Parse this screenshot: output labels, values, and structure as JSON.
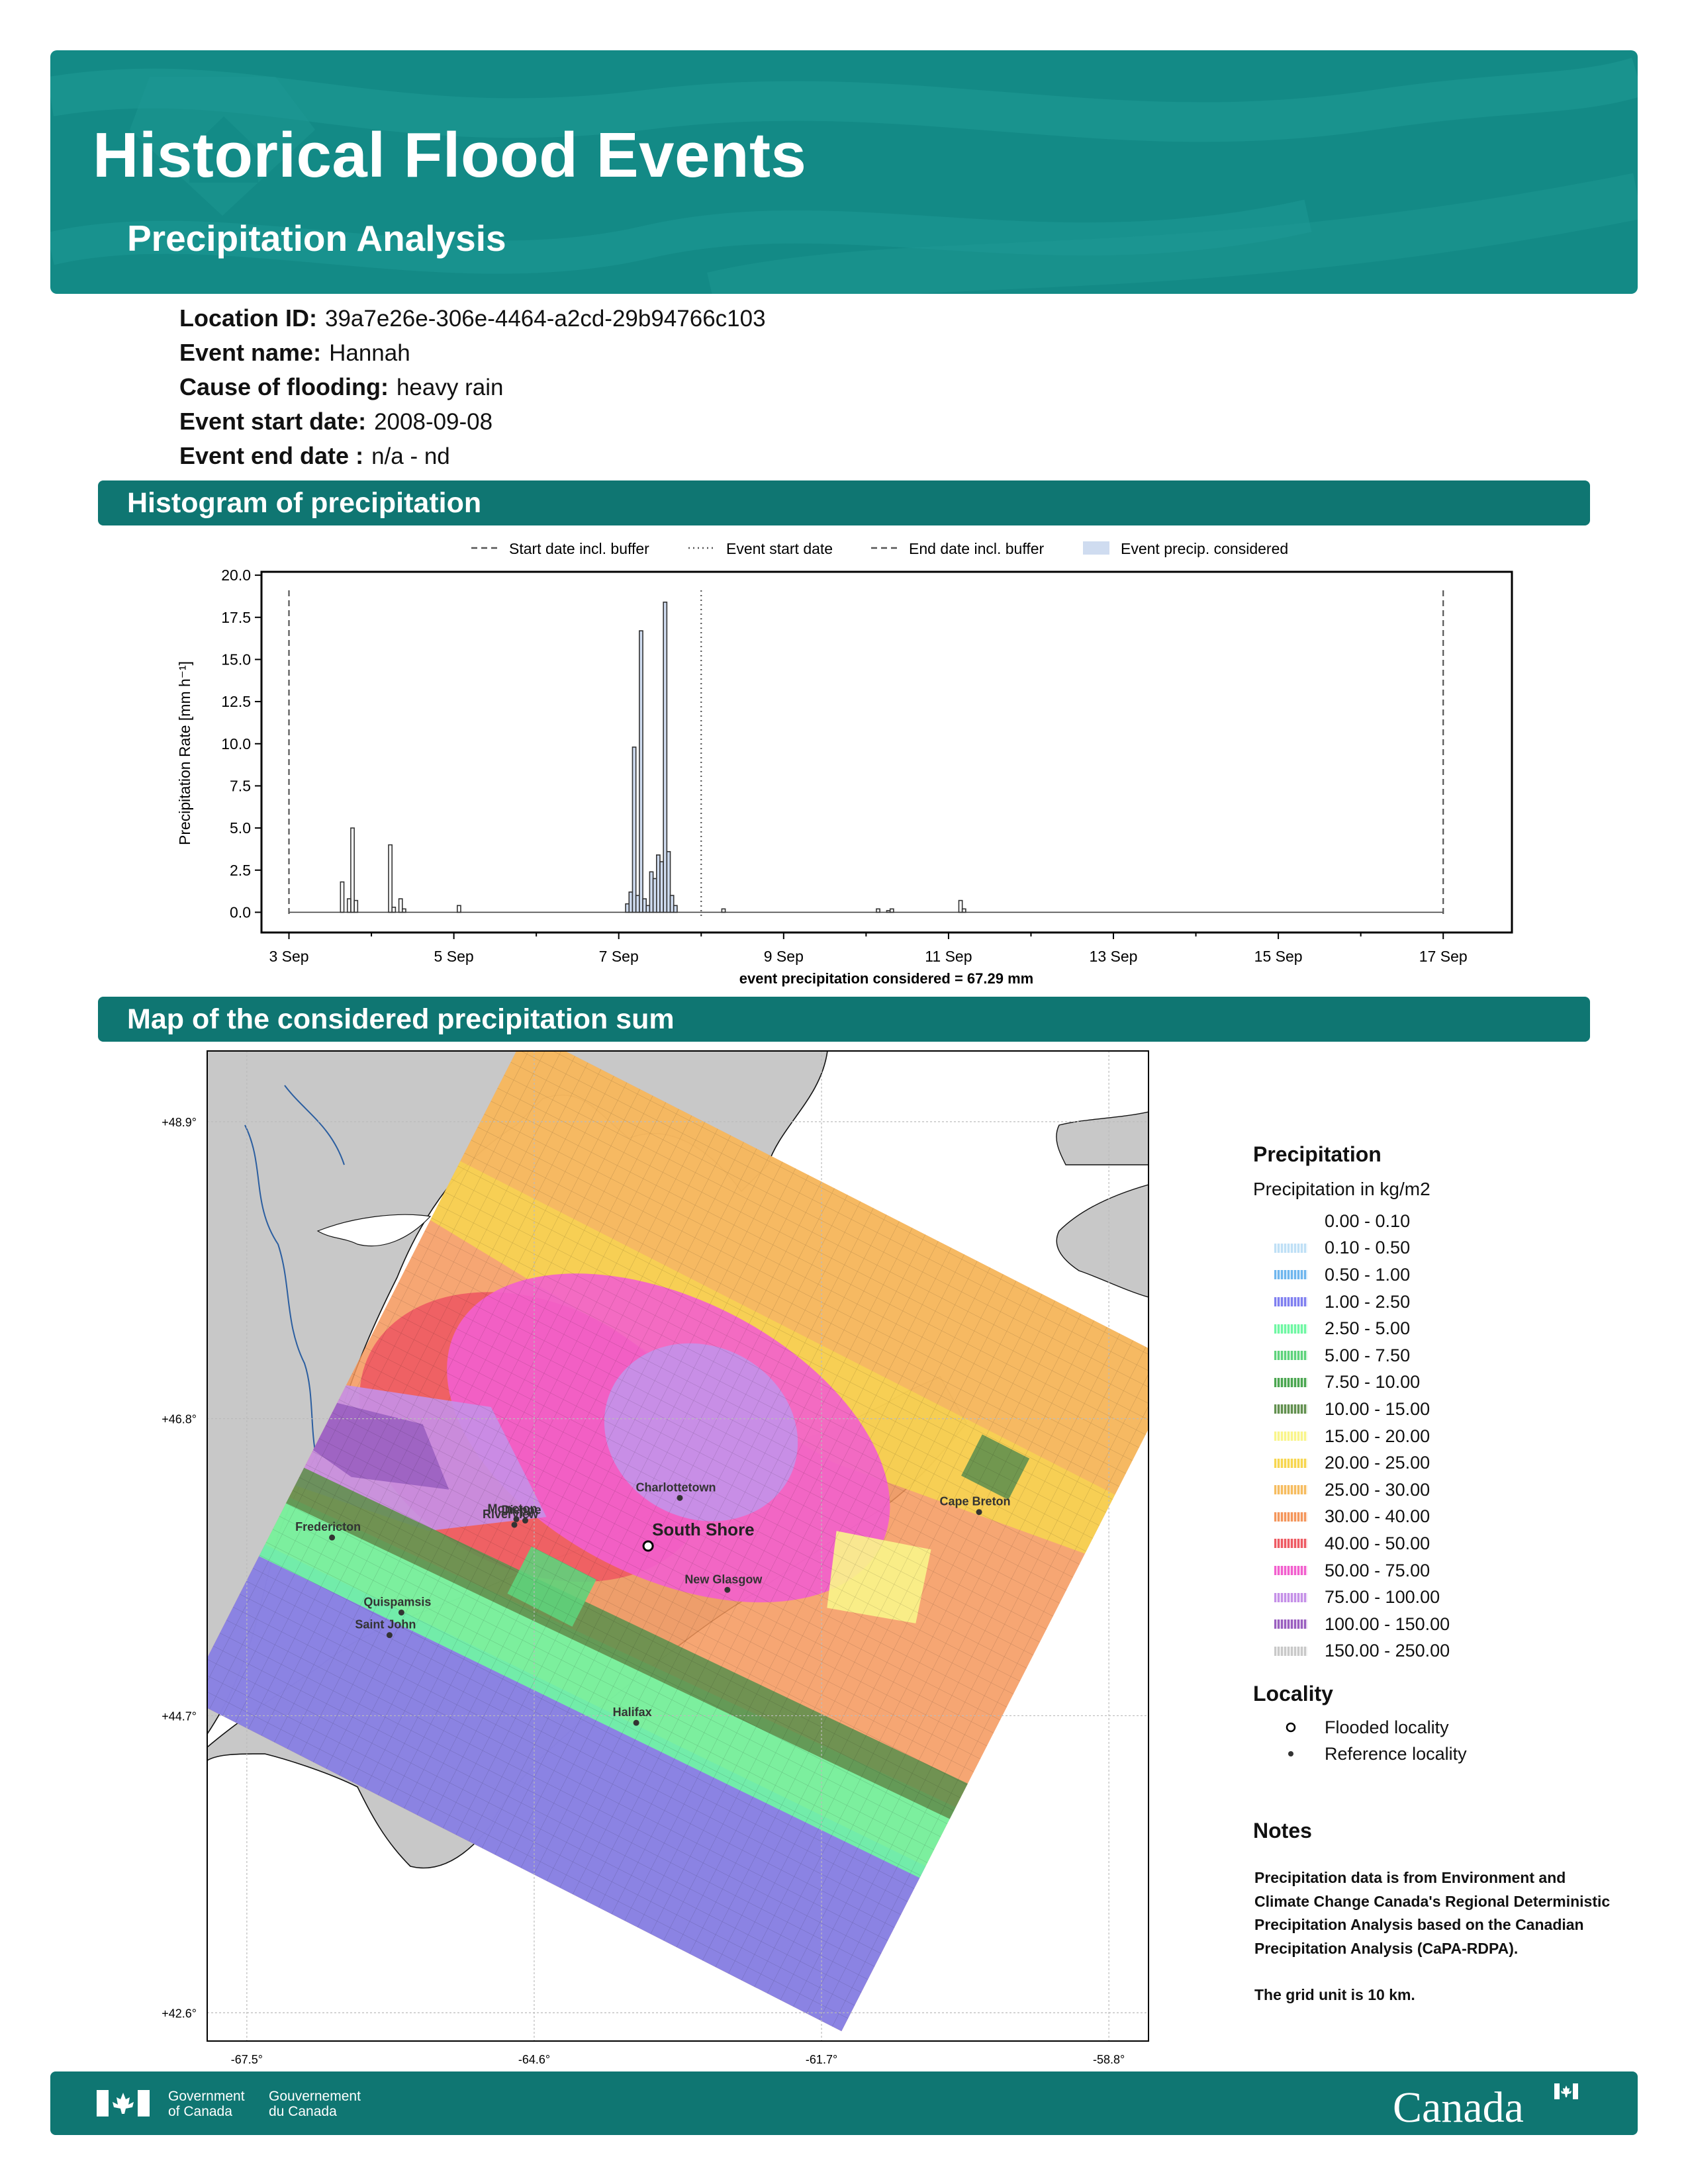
{
  "header": {
    "title": "Historical Flood Events",
    "subtitle": "Precipitation Analysis"
  },
  "event_info": [
    {
      "label": "Location ID:",
      "value": "39a7e26e-306e-4464-a2cd-29b94766c103"
    },
    {
      "label": "Event name:",
      "value": "Hannah"
    },
    {
      "label": "Cause of flooding:",
      "value": "heavy rain"
    },
    {
      "label": "Event start date:",
      "value": "2008-09-08"
    },
    {
      "label": "Event end date :",
      "value": "n/a - nd"
    }
  ],
  "sections": {
    "histogram": "Histogram of precipitation",
    "map": "Map of the considered precipitation sum"
  },
  "chart_data": {
    "type": "bar",
    "ylabel": "Precipitation Rate [mm h⁻¹]",
    "footer_text": "event precipitation considered = 67.29 mm",
    "ylim": [
      -1.2,
      20.2
    ],
    "xlim_days": [
      "2008-09-02 16:00",
      "2008-09-17 20:00"
    ],
    "yticks": [
      "0.0",
      "2.5",
      "5.0",
      "7.5",
      "10.0",
      "12.5",
      "15.0",
      "17.5",
      "20.0"
    ],
    "xticks": [
      "3 Sep",
      "5 Sep",
      "7 Sep",
      "9 Sep",
      "11 Sep",
      "13 Sep",
      "15 Sep",
      "17 Sep"
    ],
    "legend": [
      {
        "label": "Start date incl. buffer",
        "style": "dashed"
      },
      {
        "label": "Event start date",
        "style": "dotted"
      },
      {
        "label": "End date incl. buffer",
        "style": "dashed"
      },
      {
        "label": "Event precip. considered",
        "style": "fill",
        "color": "#cfdcf0"
      }
    ],
    "vlines": [
      {
        "date": "2008-09-03 00:00",
        "style": "dashed"
      },
      {
        "date": "2008-09-08 00:00",
        "style": "dotted"
      },
      {
        "date": "2008-09-17 00:00",
        "style": "dashed"
      }
    ],
    "bars": [
      {
        "date": "2008-09-03 15:00",
        "value": 1.8
      },
      {
        "date": "2008-09-03 17:00",
        "value": 0.8
      },
      {
        "date": "2008-09-03 18:00",
        "value": 5.0
      },
      {
        "date": "2008-09-03 19:00",
        "value": 0.7
      },
      {
        "date": "2008-09-04 05:00",
        "value": 4.0
      },
      {
        "date": "2008-09-04 06:00",
        "value": 0.3
      },
      {
        "date": "2008-09-04 08:00",
        "value": 0.8
      },
      {
        "date": "2008-09-04 09:00",
        "value": 0.2
      },
      {
        "date": "2008-09-05 01:00",
        "value": 0.4
      },
      {
        "date": "2008-09-07 02:00",
        "value": 0.5
      },
      {
        "date": "2008-09-07 03:00",
        "value": 1.2
      },
      {
        "date": "2008-09-07 04:00",
        "value": 9.8
      },
      {
        "date": "2008-09-07 05:00",
        "value": 1.0
      },
      {
        "date": "2008-09-07 06:00",
        "value": 16.7
      },
      {
        "date": "2008-09-07 07:00",
        "value": 0.8
      },
      {
        "date": "2008-09-07 08:00",
        "value": 0.4
      },
      {
        "date": "2008-09-07 09:00",
        "value": 2.4
      },
      {
        "date": "2008-09-07 10:00",
        "value": 2.0
      },
      {
        "date": "2008-09-07 11:00",
        "value": 3.4
      },
      {
        "date": "2008-09-07 12:00",
        "value": 3.0
      },
      {
        "date": "2008-09-07 13:00",
        "value": 18.4
      },
      {
        "date": "2008-09-07 14:00",
        "value": 3.6
      },
      {
        "date": "2008-09-07 15:00",
        "value": 1.0
      },
      {
        "date": "2008-09-07 16:00",
        "value": 0.4
      },
      {
        "date": "2008-09-08 06:00",
        "value": 0.2
      },
      {
        "date": "2008-09-10 03:00",
        "value": 0.2
      },
      {
        "date": "2008-09-10 06:00",
        "value": 0.1
      },
      {
        "date": "2008-09-10 07:00",
        "value": 0.2
      },
      {
        "date": "2008-09-11 03:00",
        "value": 0.7
      },
      {
        "date": "2008-09-11 04:00",
        "value": 0.2
      }
    ],
    "considered_range": [
      "2008-09-07 00:00",
      "2008-09-08 00:00"
    ]
  },
  "map": {
    "lat_labels": [
      "+48.9°",
      "+46.8°",
      "+44.7°",
      "+42.6°"
    ],
    "lon_labels": [
      "-67.5°",
      "-64.6°",
      "-61.7°",
      "-58.8°"
    ],
    "lat_values": [
      48.9,
      46.8,
      44.7,
      42.6
    ],
    "lon_values": [
      -67.5,
      -64.6,
      -61.7,
      -58.8
    ],
    "extent": {
      "lon": [
        -67.9,
        -58.4
      ],
      "lat": [
        42.4,
        49.4
      ]
    },
    "flooded_locality": {
      "name": "South Shore",
      "lon": -63.45,
      "lat": 45.9
    },
    "localities": [
      {
        "name": "Charlottetown",
        "lon": -63.13,
        "lat": 46.24
      },
      {
        "name": "Moncton",
        "lon": -64.78,
        "lat": 46.09
      },
      {
        "name": "Dieppe",
        "lon": -64.69,
        "lat": 46.08
      },
      {
        "name": "Riverview",
        "lon": -64.8,
        "lat": 46.05
      },
      {
        "name": "Fredericton",
        "lon": -66.64,
        "lat": 45.96
      },
      {
        "name": "Cape Breton",
        "lon": -60.11,
        "lat": 46.14
      },
      {
        "name": "New Glasgow",
        "lon": -62.65,
        "lat": 45.59
      },
      {
        "name": "Quispamsis",
        "lon": -65.94,
        "lat": 45.43
      },
      {
        "name": "Saint John",
        "lon": -66.06,
        "lat": 45.27
      },
      {
        "name": "Halifax",
        "lon": -63.57,
        "lat": 44.65
      }
    ]
  },
  "legend": {
    "title": "Precipitation",
    "subtitle": "Precipitation in kg/m2",
    "classes": [
      {
        "label": "0.00 - 0.10",
        "color": "#ffffff"
      },
      {
        "label": "0.10 - 0.50",
        "color": "#bfe0f6"
      },
      {
        "label": "0.50 - 1.00",
        "color": "#6fb6ee"
      },
      {
        "label": "1.00 - 2.50",
        "color": "#7f7ff0"
      },
      {
        "label": "2.50 - 5.00",
        "color": "#6ff7a3"
      },
      {
        "label": "5.00 - 7.50",
        "color": "#5ed37b"
      },
      {
        "label": "7.50 - 10.00",
        "color": "#4aa650"
      },
      {
        "label": "10.00 - 15.00",
        "color": "#62904f"
      },
      {
        "label": "15.00 - 20.00",
        "color": "#f9f58a"
      },
      {
        "label": "20.00 - 25.00",
        "color": "#f7d64f"
      },
      {
        "label": "25.00 - 30.00",
        "color": "#f6bc5f"
      },
      {
        "label": "30.00 - 40.00",
        "color": "#f4965b"
      },
      {
        "label": "40.00 - 50.00",
        "color": "#ee5a63"
      },
      {
        "label": "50.00 - 75.00",
        "color": "#f25fce"
      },
      {
        "label": "75.00 - 100.00",
        "color": "#c590e8"
      },
      {
        "label": "100.00 - 150.00",
        "color": "#9a5fc0"
      },
      {
        "label": "150.00 - 250.00",
        "color": "#c9c9c9"
      }
    ],
    "locality_title": "Locality",
    "flooded_label": "Flooded locality",
    "reference_label": "Reference locality"
  },
  "notes": {
    "title": "Notes",
    "text1": "Precipitation data is from Environment and Climate Change Canada's Regional Deterministic Precipitation Analysis based on the Canadian Precipitation Analysis (CaPA-RDPA).",
    "text2": "The grid unit is 10 km."
  },
  "footer": {
    "gov_en": "Government of Canada",
    "gov_fr": "Gouvernement du Canada",
    "wordmark": "Canada"
  }
}
